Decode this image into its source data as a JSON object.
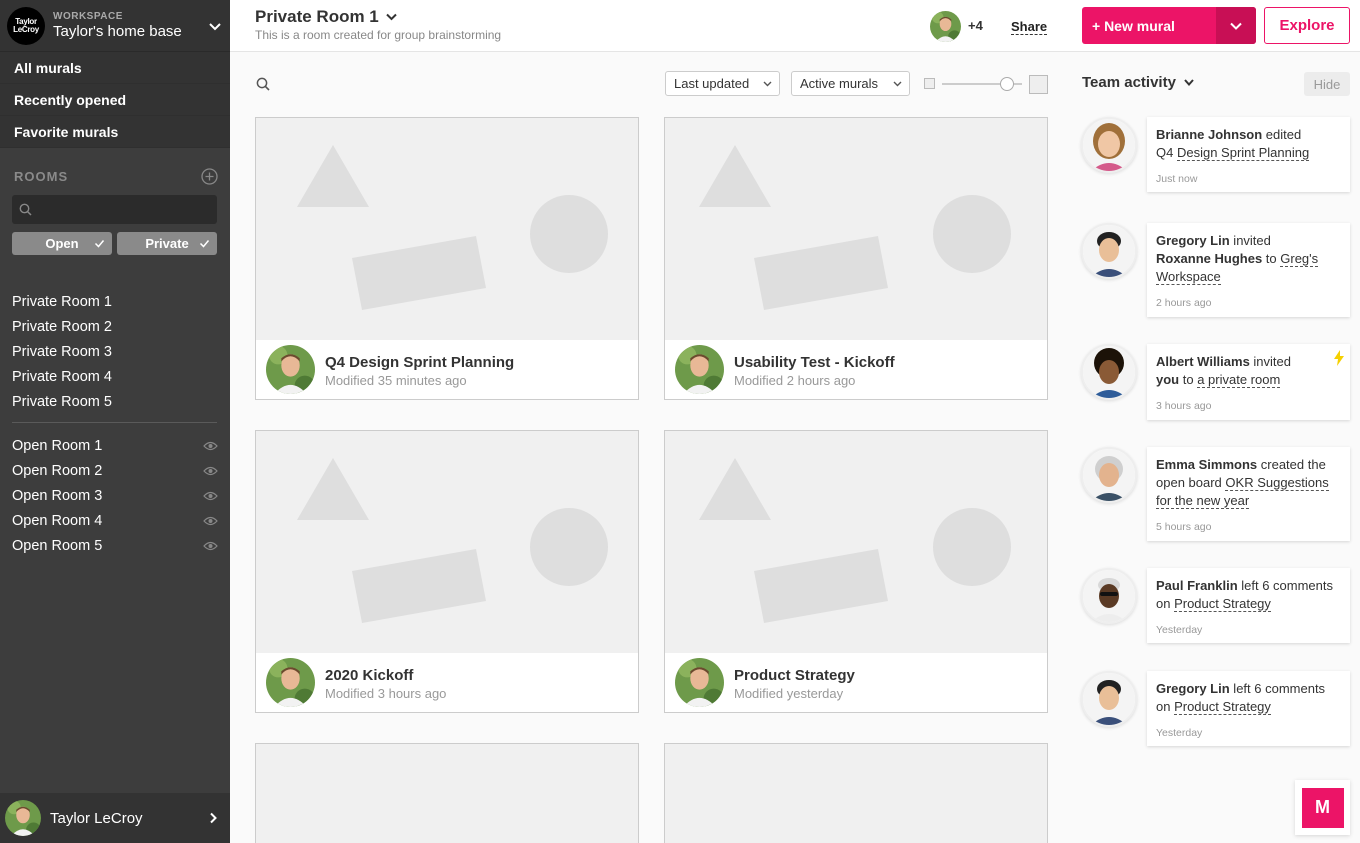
{
  "sidebar": {
    "workspace_logo_line1": "Taylor",
    "workspace_logo_line2": "LeCroy",
    "workspace_label": "WORKSPACE",
    "workspace_name": "Taylor's home base",
    "nav": [
      "All murals",
      "Recently opened",
      "Favorite murals"
    ],
    "rooms_title": "ROOMS",
    "room_search_placeholder": "",
    "filters": [
      "Open",
      "Private"
    ],
    "private_rooms": [
      "Private Room 1",
      "Private Room 2",
      "Private Room 3",
      "Private Room 4",
      "Private Room 5"
    ],
    "open_rooms": [
      "Open Room 1",
      "Open Room 2",
      "Open Room 3",
      "Open Room 4",
      "Open Room 5"
    ],
    "user_name": "Taylor LeCroy"
  },
  "header": {
    "room_title": "Private Room 1",
    "room_description": "This is a room created for group brainstorming",
    "member_count": "+4",
    "share_label": "Share",
    "new_mural_label": "+ New mural",
    "explore_label": "Explore"
  },
  "toolbar": {
    "sort_label": "Last updated",
    "filter_label": "Active murals"
  },
  "murals": [
    {
      "title": "Q4 Design Sprint Planning",
      "modified": "Modified 35 minutes ago"
    },
    {
      "title": "Usability Test - Kickoff",
      "modified": "Modified 2 hours ago"
    },
    {
      "title": "2020 Kickoff",
      "modified": "Modified 3 hours ago"
    },
    {
      "title": "Product Strategy",
      "modified": "Modified yesterday"
    }
  ],
  "team_activity": {
    "title": "Team activity",
    "hide_label": "Hide",
    "items": [
      {
        "actor": "Brianne Johnson",
        "verb": " edited",
        "line2_prefix": "Q4 ",
        "link": "Design Sprint Planning",
        "time": "Just now"
      },
      {
        "actor": "Gregory Lin",
        "verb": " invited",
        "target": "Roxanne Hughes",
        "mid": " to ",
        "link_a": "Greg's",
        "link_b": "Workspace",
        "time": "2 hours ago"
      },
      {
        "actor": "Albert Williams",
        "verb": " invited",
        "target": "you",
        "mid": " to ",
        "link": "a private room",
        "time": "3 hours ago"
      },
      {
        "actor": "Emma Simmons",
        "verb": " created the",
        "line2_prefix": "open board ",
        "link_a": "OKR Suggestions",
        "link_b": "for the new year",
        "time": "5 hours ago"
      },
      {
        "actor": "Paul Franklin",
        "verb": " left 6 comments",
        "line2_prefix": "on ",
        "link": "Product Strategy",
        "time": "Yesterday"
      },
      {
        "actor": "Gregory Lin",
        "verb": " left 6 comments",
        "line2_prefix": "on ",
        "link": "Product Strategy",
        "time": "Yesterday"
      }
    ]
  },
  "logo_letter": "M",
  "colors": {
    "accent": "#ec1467",
    "sidebar": "#3d3d3d"
  }
}
